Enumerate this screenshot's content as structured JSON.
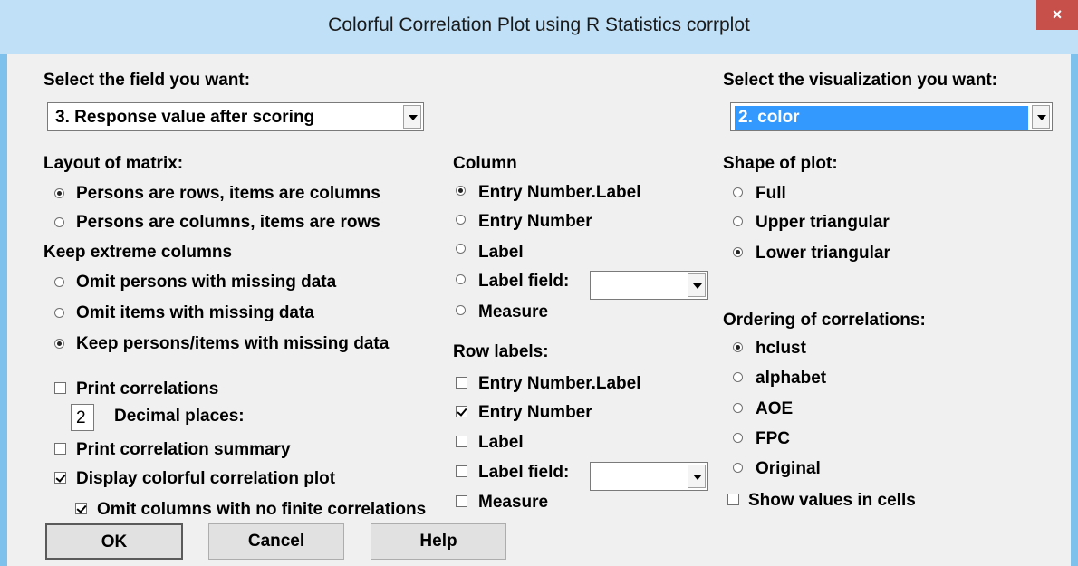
{
  "window": {
    "title": "Colorful Correlation Plot using R Statistics corrplot",
    "close_glyph": "×"
  },
  "field": {
    "label": "Select the field you want:",
    "selected": "3. Response value after scoring"
  },
  "visualization": {
    "label": "Select the visualization you want:",
    "selected": "2. color"
  },
  "layout": {
    "label": "Layout of matrix:",
    "options": [
      "Persons are rows, items are columns",
      "Persons are columns, items are rows"
    ],
    "selected_index": 0
  },
  "extreme": {
    "label": "Keep extreme columns",
    "options": [
      "Omit persons with missing data",
      "Omit items with missing data",
      "Keep persons/items with missing data"
    ],
    "selected_index": 2
  },
  "options": {
    "print_correlations": "Print correlations",
    "print_correlations_checked": false,
    "decimal_value": "2",
    "decimal_label": "Decimal places:",
    "print_summary": "Print correlation summary",
    "print_summary_checked": false,
    "display_plot": "Display colorful correlation plot",
    "display_plot_checked": true,
    "omit_columns": "Omit columns with no finite correlations",
    "omit_columns_checked": true
  },
  "column": {
    "label": "Column",
    "options": [
      "Entry Number.Label",
      "Entry Number",
      "Label",
      "Label field:",
      "Measure"
    ],
    "selected_index": 0
  },
  "row_labels": {
    "label": "Row labels:",
    "options": [
      "Entry Number.Label",
      "Entry Number",
      "Label",
      "Label field:",
      "Measure"
    ],
    "checked": [
      false,
      true,
      false,
      false,
      false
    ]
  },
  "shape": {
    "label": "Shape of plot:",
    "options": [
      "Full",
      "Upper triangular",
      "Lower triangular"
    ],
    "selected_index": 2
  },
  "ordering": {
    "label": "Ordering of correlations:",
    "options": [
      "hclust",
      "alphabet",
      "AOE",
      "FPC",
      "Original"
    ],
    "selected_index": 0
  },
  "show_values": {
    "label": "Show values in cells",
    "checked": false
  },
  "buttons": {
    "ok": "OK",
    "cancel": "Cancel",
    "help": "Help"
  }
}
